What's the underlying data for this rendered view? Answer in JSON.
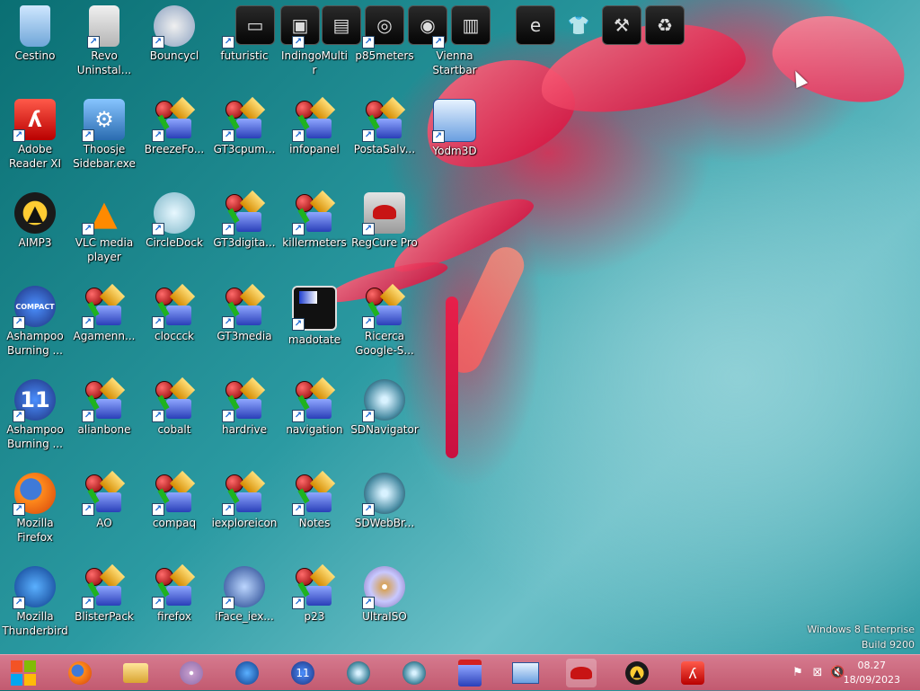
{
  "desktop_icons": [
    {
      "label": "Cestino",
      "icon": "recycle-bin-icon"
    },
    {
      "label": "Revo Uninstal...",
      "icon": "revo-uninstaller-icon"
    },
    {
      "label": "Bouncycl",
      "icon": "bouncyclock-icon"
    },
    {
      "label": "futuristic",
      "icon": "gt-widget-icon"
    },
    {
      "label": "IndingoMultir",
      "icon": "gt-widget-icon"
    },
    {
      "label": "p85meters",
      "icon": "gt-widget-icon"
    },
    {
      "label": "Vienna Startbar",
      "icon": "gt-widget-icon"
    },
    {
      "label": "Adobe Reader XI",
      "icon": "adobe-reader-icon"
    },
    {
      "label": "Thoosje Sidebar.exe",
      "icon": "thoosje-sidebar-icon"
    },
    {
      "label": "BreezeFo...",
      "icon": "gt-widget-icon"
    },
    {
      "label": "GT3cpum...",
      "icon": "gt-widget-icon"
    },
    {
      "label": "infopanel",
      "icon": "gt-widget-icon"
    },
    {
      "label": "PostaSalv...",
      "icon": "gt-widget-icon"
    },
    {
      "label": "Yodm3D",
      "icon": "yodm3d-icon"
    },
    {
      "label": "AIMP3",
      "icon": "aimp-icon"
    },
    {
      "label": "VLC media player",
      "icon": "vlc-cone-icon"
    },
    {
      "label": "CircleDock",
      "icon": "circledock-icon"
    },
    {
      "label": "GT3digita...",
      "icon": "gt-widget-icon"
    },
    {
      "label": "killermeters",
      "icon": "gt-widget-icon"
    },
    {
      "label": "RegCure Pro",
      "icon": "regcure-icon"
    },
    {
      "label": "Ashampoo Burning ...",
      "icon": "ashampoo-compact-icon"
    },
    {
      "label": "Agamenn...",
      "icon": "gt-widget-icon"
    },
    {
      "label": "cloccck",
      "icon": "gt-widget-icon"
    },
    {
      "label": "GT3media",
      "icon": "gt-widget-icon"
    },
    {
      "label": "madotate",
      "icon": "madotate-icon"
    },
    {
      "label": "Ricerca Google-S...",
      "icon": "gt-widget-icon"
    },
    {
      "label": "Ashampoo Burning ...",
      "icon": "ashampoo-11-icon"
    },
    {
      "label": "alianbone",
      "icon": "gt-widget-icon"
    },
    {
      "label": "cobalt",
      "icon": "gt-widget-icon"
    },
    {
      "label": "hardrive",
      "icon": "gt-widget-icon"
    },
    {
      "label": "navigation",
      "icon": "gt-widget-icon"
    },
    {
      "label": "SDNavigator",
      "icon": "sd-sphere-icon"
    },
    {
      "label": "Mozilla Firefox",
      "icon": "firefox-icon"
    },
    {
      "label": "AO",
      "icon": "gt-widget-icon"
    },
    {
      "label": "compaq",
      "icon": "gt-widget-icon"
    },
    {
      "label": "iexploreicon",
      "icon": "gt-widget-icon"
    },
    {
      "label": "Notes",
      "icon": "gt-widget-icon"
    },
    {
      "label": "SDWebBr...",
      "icon": "sd-sphere-icon"
    },
    {
      "label": "Mozilla Thunderbird",
      "icon": "thunderbird-icon"
    },
    {
      "label": "BlisterPack",
      "icon": "gt-widget-icon"
    },
    {
      "label": "firefox",
      "icon": "gt-widget-icon"
    },
    {
      "label": "iFace_iex...",
      "icon": "iface-icon"
    },
    {
      "label": "p23",
      "icon": "gt-widget-icon"
    },
    {
      "label": "UltraISO",
      "icon": "ultraiso-disc-icon"
    }
  ],
  "dock": {
    "items": [
      {
        "icon": "monitor-icon"
      },
      {
        "icon": "dark-folder-icon"
      },
      {
        "icon": "folder-icon"
      },
      {
        "icon": "speaker-icon"
      },
      {
        "icon": "speaker-grille-icon"
      },
      {
        "icon": "equalizer-icon"
      },
      {
        "icon": "internet-explorer-icon"
      },
      {
        "icon": "tshirt-icon"
      },
      {
        "icon": "tools-icon"
      },
      {
        "icon": "recycle-icon"
      }
    ]
  },
  "watermark": {
    "line1": "Windows 8 Enterprise",
    "line2": "Build 9200"
  },
  "taskbar": {
    "items": [
      {
        "icon": "firefox-icon"
      },
      {
        "icon": "file-explorer-icon"
      },
      {
        "icon": "disc-icon"
      },
      {
        "icon": "thunderbird-icon"
      },
      {
        "icon": "ashampoo-11-icon"
      },
      {
        "icon": "sd-sphere-icon"
      },
      {
        "icon": "sd-sphere-icon"
      },
      {
        "icon": "gt-widget-icon"
      },
      {
        "icon": "yodm3d-icon"
      },
      {
        "icon": "regcure-icon"
      },
      {
        "icon": "aimp-icon"
      },
      {
        "icon": "adobe-reader-icon"
      }
    ],
    "clock": {
      "time": "08.27",
      "date": "18/09/2023"
    }
  }
}
